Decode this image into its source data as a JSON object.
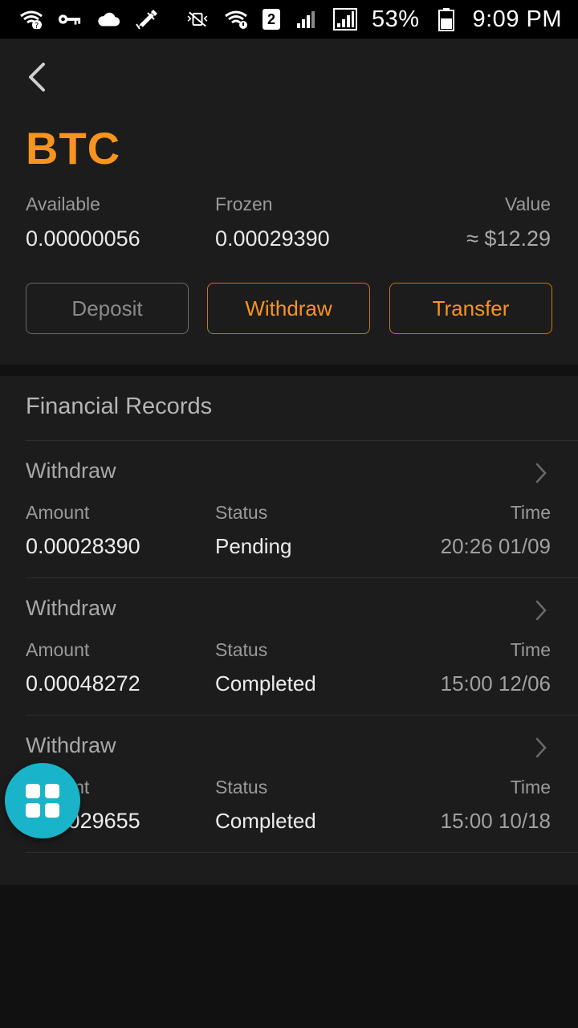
{
  "status_bar": {
    "battery": "53%",
    "time": "9:09 PM",
    "sim_slot": "2",
    "icons": [
      "wifi-question-icon",
      "key-icon",
      "cloud-icon",
      "satellite-icon",
      "mute-vibrate-icon",
      "wifi-icon",
      "signal-icon",
      "signal-icon",
      "battery-icon"
    ]
  },
  "header": {
    "back_icon": "chevron-left-icon",
    "coin": "BTC",
    "accent_color": "#f7941d",
    "available_label": "Available",
    "available_value": "0.00000056",
    "frozen_label": "Frozen",
    "frozen_value": "0.00029390",
    "value_label": "Value",
    "value_value": "≈ $12.29",
    "buttons": {
      "deposit": "Deposit",
      "withdraw": "Withdraw",
      "transfer": "Transfer"
    }
  },
  "records": {
    "title": "Financial Records",
    "amount_label": "Amount",
    "status_label": "Status",
    "time_label": "Time",
    "items": [
      {
        "type": "Withdraw",
        "amount": "0.00028390",
        "status": "Pending",
        "time": "20:26 01/09"
      },
      {
        "type": "Withdraw",
        "amount": "0.00048272",
        "status": "Completed",
        "time": "15:00 12/06"
      },
      {
        "type": "Withdraw",
        "amount": "0.00029655",
        "status": "Completed",
        "time": "15:00 10/18"
      }
    ]
  },
  "fab": {
    "icon": "grid-menu-icon",
    "color": "#19b4c9"
  }
}
